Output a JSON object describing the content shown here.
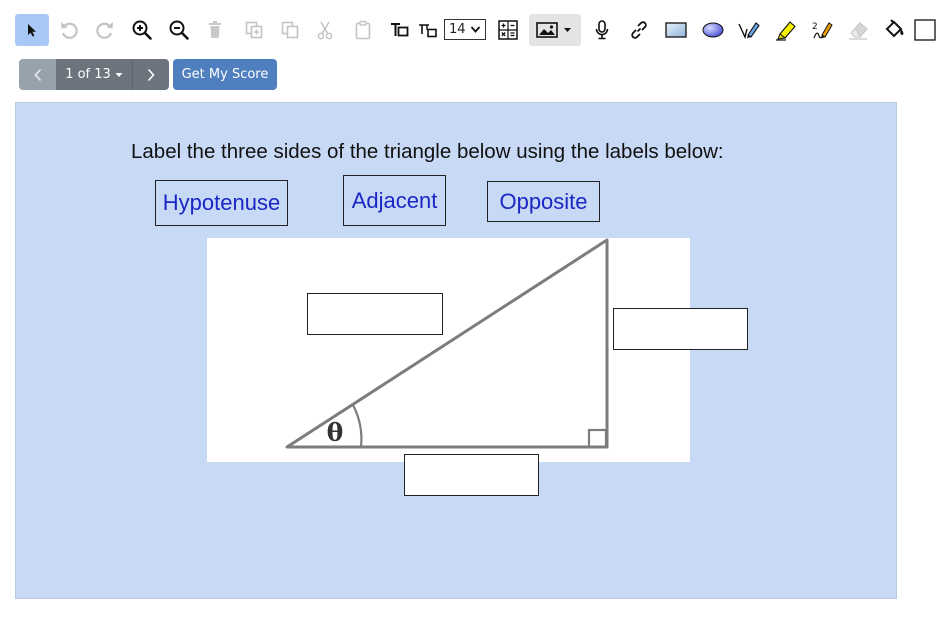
{
  "toolbar": {
    "font_size": "14",
    "tools": [
      {
        "icon": "select-arrow-icon",
        "active": true
      },
      {
        "icon": "undo-icon"
      },
      {
        "icon": "redo-icon"
      },
      {
        "icon": "zoom-in-icon"
      },
      {
        "icon": "zoom-out-icon"
      },
      {
        "icon": "delete-icon"
      },
      {
        "icon": "copy-icon"
      },
      {
        "icon": "duplicate-icon"
      },
      {
        "icon": "cut-icon"
      },
      {
        "icon": "paste-icon"
      },
      {
        "icon": "text-box-icon"
      },
      {
        "icon": "text-size-icon"
      },
      {
        "icon": "math-calculator-icon"
      },
      {
        "icon": "image-insert-icon"
      },
      {
        "icon": "microphone-icon"
      },
      {
        "icon": "link-icon"
      },
      {
        "icon": "rectangle-icon"
      },
      {
        "icon": "ellipse-icon"
      },
      {
        "icon": "pen-icon"
      },
      {
        "icon": "highlighter-icon"
      },
      {
        "icon": "handwriting-icon"
      },
      {
        "icon": "eraser-icon"
      },
      {
        "icon": "fill-bucket-icon"
      }
    ]
  },
  "navigation": {
    "page_indicator": "1 of 13",
    "score_button": "Get My Score"
  },
  "question": {
    "instruction": "Label the three sides of the triangle below using the labels below:",
    "labels": [
      "Hypotenuse",
      "Adjacent",
      "Opposite"
    ],
    "angle_symbol": "θ"
  },
  "colors": {
    "canvas_background": "#c8d9f6",
    "label_text": "#1a27c4",
    "active_tool": "#a9c8f5",
    "score_button": "#4f7fbf",
    "nav_button": "#6c757e"
  }
}
